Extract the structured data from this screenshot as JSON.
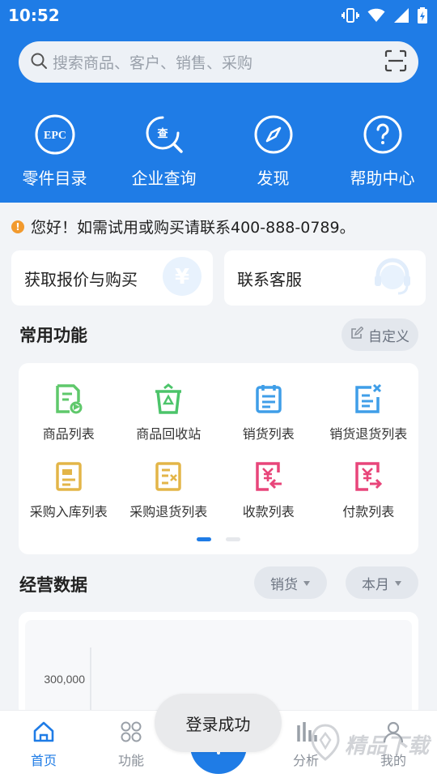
{
  "status_bar": {
    "time": "10:52"
  },
  "search": {
    "placeholder": "搜索商品、客户、销售、采购"
  },
  "quick_nav": [
    {
      "label": "零件目录",
      "icon": "epc-icon",
      "badge": "EPC"
    },
    {
      "label": "企业查询",
      "icon": "enterprise-search-icon",
      "badge": "查"
    },
    {
      "label": "发现",
      "icon": "compass-icon"
    },
    {
      "label": "帮助中心",
      "icon": "help-icon"
    }
  ],
  "notice": {
    "text": "您好！如需试用或购买请联系400-888-0789。"
  },
  "cards": [
    {
      "label": "获取报价与购买",
      "icon": "yen-icon",
      "glyph": "¥"
    },
    {
      "label": "联系客服",
      "icon": "headset-icon"
    }
  ],
  "common": {
    "title": "常用功能",
    "customize_label": "自定义",
    "items": [
      {
        "label": "商品列表",
        "color": "#5fc86b"
      },
      {
        "label": "商品回收站",
        "color": "#4cc46a"
      },
      {
        "label": "销货列表",
        "color": "#3f9ee8"
      },
      {
        "label": "销货退货列表",
        "color": "#3f9ee8"
      },
      {
        "label": "采购入库列表",
        "color": "#e3b548"
      },
      {
        "label": "采购退货列表",
        "color": "#e3b548"
      },
      {
        "label": "收款列表",
        "color": "#e8457a"
      },
      {
        "label": "付款列表",
        "color": "#e8457a"
      }
    ]
  },
  "business": {
    "title": "经营数据",
    "filter_type": "销货",
    "filter_period": "本月"
  },
  "chart_data": {
    "type": "line",
    "ytick_labels": [
      "300,000"
    ]
  },
  "bottom_nav": [
    {
      "label": "首页",
      "icon": "home-icon",
      "active": true
    },
    {
      "label": "功能",
      "icon": "grid-icon",
      "active": false
    },
    {
      "label": "",
      "icon": "plus-icon",
      "active": false
    },
    {
      "label": "分析",
      "icon": "bar-chart-icon",
      "active": false
    },
    {
      "label": "我的",
      "icon": "user-icon",
      "active": false
    }
  ],
  "toast": {
    "text": "登录成功"
  },
  "watermark": {
    "text": "精品下载"
  },
  "colors": {
    "primary": "#1f7ce6",
    "background": "#f2f4f7",
    "notice": "#f29a2e"
  }
}
